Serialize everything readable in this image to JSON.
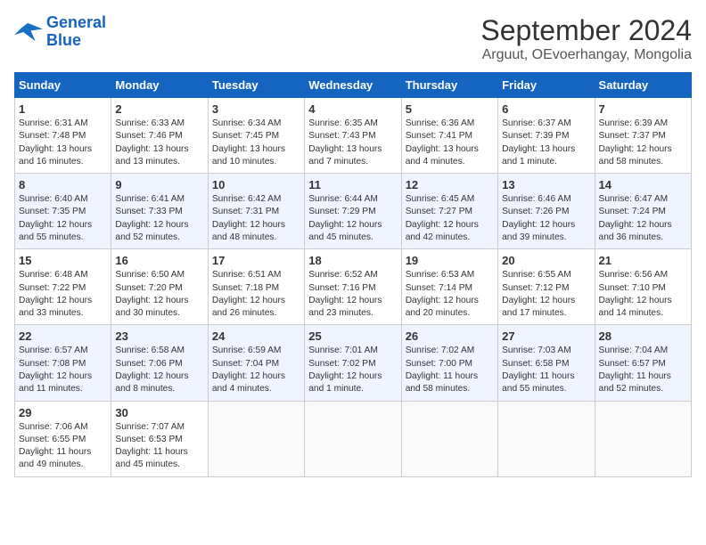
{
  "header": {
    "logo_line1": "General",
    "logo_line2": "Blue",
    "title": "September 2024",
    "subtitle": "Arguut, OEvoerhangay, Mongolia"
  },
  "days_of_week": [
    "Sunday",
    "Monday",
    "Tuesday",
    "Wednesday",
    "Thursday",
    "Friday",
    "Saturday"
  ],
  "weeks": [
    [
      {
        "day": 1,
        "lines": [
          "Sunrise: 6:31 AM",
          "Sunset: 7:48 PM",
          "Daylight: 13 hours",
          "and 16 minutes."
        ]
      },
      {
        "day": 2,
        "lines": [
          "Sunrise: 6:33 AM",
          "Sunset: 7:46 PM",
          "Daylight: 13 hours",
          "and 13 minutes."
        ]
      },
      {
        "day": 3,
        "lines": [
          "Sunrise: 6:34 AM",
          "Sunset: 7:45 PM",
          "Daylight: 13 hours",
          "and 10 minutes."
        ]
      },
      {
        "day": 4,
        "lines": [
          "Sunrise: 6:35 AM",
          "Sunset: 7:43 PM",
          "Daylight: 13 hours",
          "and 7 minutes."
        ]
      },
      {
        "day": 5,
        "lines": [
          "Sunrise: 6:36 AM",
          "Sunset: 7:41 PM",
          "Daylight: 13 hours",
          "and 4 minutes."
        ]
      },
      {
        "day": 6,
        "lines": [
          "Sunrise: 6:37 AM",
          "Sunset: 7:39 PM",
          "Daylight: 13 hours",
          "and 1 minute."
        ]
      },
      {
        "day": 7,
        "lines": [
          "Sunrise: 6:39 AM",
          "Sunset: 7:37 PM",
          "Daylight: 12 hours",
          "and 58 minutes."
        ]
      }
    ],
    [
      {
        "day": 8,
        "lines": [
          "Sunrise: 6:40 AM",
          "Sunset: 7:35 PM",
          "Daylight: 12 hours",
          "and 55 minutes."
        ]
      },
      {
        "day": 9,
        "lines": [
          "Sunrise: 6:41 AM",
          "Sunset: 7:33 PM",
          "Daylight: 12 hours",
          "and 52 minutes."
        ]
      },
      {
        "day": 10,
        "lines": [
          "Sunrise: 6:42 AM",
          "Sunset: 7:31 PM",
          "Daylight: 12 hours",
          "and 48 minutes."
        ]
      },
      {
        "day": 11,
        "lines": [
          "Sunrise: 6:44 AM",
          "Sunset: 7:29 PM",
          "Daylight: 12 hours",
          "and 45 minutes."
        ]
      },
      {
        "day": 12,
        "lines": [
          "Sunrise: 6:45 AM",
          "Sunset: 7:27 PM",
          "Daylight: 12 hours",
          "and 42 minutes."
        ]
      },
      {
        "day": 13,
        "lines": [
          "Sunrise: 6:46 AM",
          "Sunset: 7:26 PM",
          "Daylight: 12 hours",
          "and 39 minutes."
        ]
      },
      {
        "day": 14,
        "lines": [
          "Sunrise: 6:47 AM",
          "Sunset: 7:24 PM",
          "Daylight: 12 hours",
          "and 36 minutes."
        ]
      }
    ],
    [
      {
        "day": 15,
        "lines": [
          "Sunrise: 6:48 AM",
          "Sunset: 7:22 PM",
          "Daylight: 12 hours",
          "and 33 minutes."
        ]
      },
      {
        "day": 16,
        "lines": [
          "Sunrise: 6:50 AM",
          "Sunset: 7:20 PM",
          "Daylight: 12 hours",
          "and 30 minutes."
        ]
      },
      {
        "day": 17,
        "lines": [
          "Sunrise: 6:51 AM",
          "Sunset: 7:18 PM",
          "Daylight: 12 hours",
          "and 26 minutes."
        ]
      },
      {
        "day": 18,
        "lines": [
          "Sunrise: 6:52 AM",
          "Sunset: 7:16 PM",
          "Daylight: 12 hours",
          "and 23 minutes."
        ]
      },
      {
        "day": 19,
        "lines": [
          "Sunrise: 6:53 AM",
          "Sunset: 7:14 PM",
          "Daylight: 12 hours",
          "and 20 minutes."
        ]
      },
      {
        "day": 20,
        "lines": [
          "Sunrise: 6:55 AM",
          "Sunset: 7:12 PM",
          "Daylight: 12 hours",
          "and 17 minutes."
        ]
      },
      {
        "day": 21,
        "lines": [
          "Sunrise: 6:56 AM",
          "Sunset: 7:10 PM",
          "Daylight: 12 hours",
          "and 14 minutes."
        ]
      }
    ],
    [
      {
        "day": 22,
        "lines": [
          "Sunrise: 6:57 AM",
          "Sunset: 7:08 PM",
          "Daylight: 12 hours",
          "and 11 minutes."
        ]
      },
      {
        "day": 23,
        "lines": [
          "Sunrise: 6:58 AM",
          "Sunset: 7:06 PM",
          "Daylight: 12 hours",
          "and 8 minutes."
        ]
      },
      {
        "day": 24,
        "lines": [
          "Sunrise: 6:59 AM",
          "Sunset: 7:04 PM",
          "Daylight: 12 hours",
          "and 4 minutes."
        ]
      },
      {
        "day": 25,
        "lines": [
          "Sunrise: 7:01 AM",
          "Sunset: 7:02 PM",
          "Daylight: 12 hours",
          "and 1 minute."
        ]
      },
      {
        "day": 26,
        "lines": [
          "Sunrise: 7:02 AM",
          "Sunset: 7:00 PM",
          "Daylight: 11 hours",
          "and 58 minutes."
        ]
      },
      {
        "day": 27,
        "lines": [
          "Sunrise: 7:03 AM",
          "Sunset: 6:58 PM",
          "Daylight: 11 hours",
          "and 55 minutes."
        ]
      },
      {
        "day": 28,
        "lines": [
          "Sunrise: 7:04 AM",
          "Sunset: 6:57 PM",
          "Daylight: 11 hours",
          "and 52 minutes."
        ]
      }
    ],
    [
      {
        "day": 29,
        "lines": [
          "Sunrise: 7:06 AM",
          "Sunset: 6:55 PM",
          "Daylight: 11 hours",
          "and 49 minutes."
        ]
      },
      {
        "day": 30,
        "lines": [
          "Sunrise: 7:07 AM",
          "Sunset: 6:53 PM",
          "Daylight: 11 hours",
          "and 45 minutes."
        ]
      },
      {
        "day": null,
        "lines": []
      },
      {
        "day": null,
        "lines": []
      },
      {
        "day": null,
        "lines": []
      },
      {
        "day": null,
        "lines": []
      },
      {
        "day": null,
        "lines": []
      }
    ]
  ]
}
